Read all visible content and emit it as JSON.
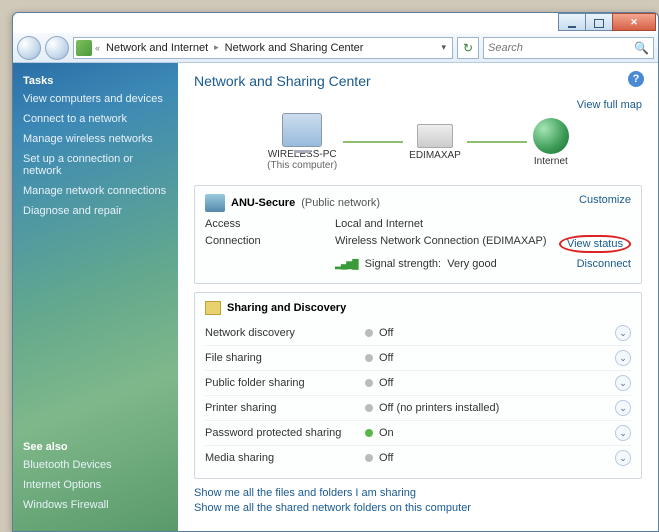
{
  "titlebar": {
    "min": "min",
    "max": "max",
    "close": "close"
  },
  "nav": {
    "crumb1": "Network and Internet",
    "crumb2": "Network and Sharing Center",
    "search_placeholder": "Search"
  },
  "sidebar": {
    "tasks_hd": "Tasks",
    "links": [
      "View computers and devices",
      "Connect to a network",
      "Manage wireless networks",
      "Set up a connection or network",
      "Manage network connections",
      "Diagnose and repair"
    ],
    "seealso_hd": "See also",
    "seealso": [
      "Bluetooth Devices",
      "Internet Options",
      "Windows Firewall"
    ]
  },
  "main": {
    "title": "Network and Sharing Center",
    "view_full_map": "View full map",
    "diagram": {
      "pc": "WIRELESS-PC",
      "pc_sub": "(This computer)",
      "ap": "EDIMAXAP",
      "internet": "Internet"
    },
    "network": {
      "name": "ANU-Secure",
      "type": "(Public network)",
      "customize": "Customize",
      "access_k": "Access",
      "access_v": "Local and Internet",
      "conn_k": "Connection",
      "conn_v_pre": "Wireless Network Connection (",
      "conn_v_ap": "EDIMAXAP",
      "conn_v_post": ")",
      "view_status": "View status",
      "signal_k": "Signal strength:",
      "signal_v": "Very good",
      "disconnect": "Disconnect"
    },
    "sd": {
      "header": "Sharing and Discovery",
      "rows": [
        {
          "k": "Network discovery",
          "on": false,
          "v": "Off"
        },
        {
          "k": "File sharing",
          "on": false,
          "v": "Off"
        },
        {
          "k": "Public folder sharing",
          "on": false,
          "v": "Off"
        },
        {
          "k": "Printer sharing",
          "on": false,
          "v": "Off (no printers installed)"
        },
        {
          "k": "Password protected sharing",
          "on": true,
          "v": "On"
        },
        {
          "k": "Media sharing",
          "on": false,
          "v": "Off"
        }
      ]
    },
    "bottom_links": [
      "Show me all the files and folders I am sharing",
      "Show me all the shared network folders on this computer"
    ]
  }
}
